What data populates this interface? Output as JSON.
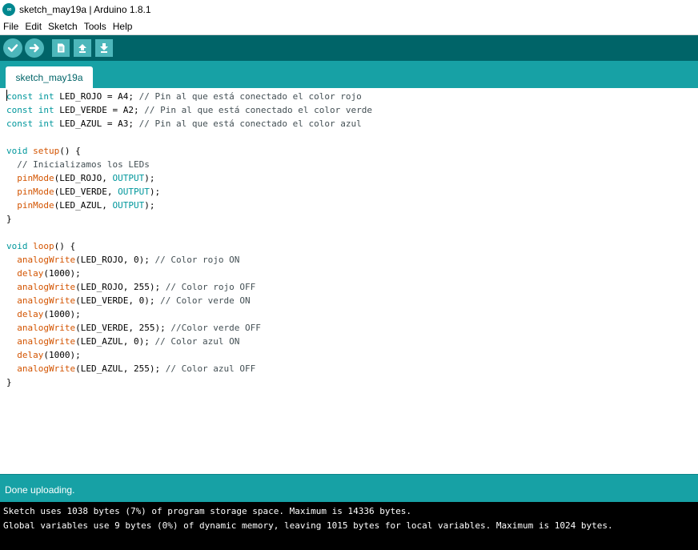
{
  "window": {
    "title": "sketch_may19a | Arduino 1.8.1",
    "logo_icon": "arduino-logo-icon",
    "logo_glyph": "∞"
  },
  "menu": [
    "File",
    "Edit",
    "Sketch",
    "Tools",
    "Help"
  ],
  "toolbar": {
    "buttons": [
      {
        "name": "verify",
        "icon": "checkmark-icon"
      },
      {
        "name": "upload",
        "icon": "arrow-right-icon"
      },
      {
        "name": "new",
        "icon": "new-file-icon"
      },
      {
        "name": "open",
        "icon": "arrow-up-icon"
      },
      {
        "name": "save",
        "icon": "arrow-down-icon"
      }
    ]
  },
  "tab": {
    "label": "sketch_may19a"
  },
  "editor": {
    "lines": [
      [
        {
          "t": "const",
          "c": "kw"
        },
        {
          "t": " "
        },
        {
          "t": "int",
          "c": "kw"
        },
        {
          "t": " LED_ROJO = A4; "
        },
        {
          "t": "// Pin al que está conectado el color rojo",
          "c": "cm"
        }
      ],
      [
        {
          "t": "const",
          "c": "kw"
        },
        {
          "t": " "
        },
        {
          "t": "int",
          "c": "kw"
        },
        {
          "t": " LED_VERDE = A2; "
        },
        {
          "t": "// Pin al que está conectado el color verde",
          "c": "cm"
        }
      ],
      [
        {
          "t": "const",
          "c": "kw"
        },
        {
          "t": " "
        },
        {
          "t": "int",
          "c": "kw"
        },
        {
          "t": " LED_AZUL = A3; "
        },
        {
          "t": "// Pin al que está conectado el color azul",
          "c": "cm"
        }
      ],
      [],
      [
        {
          "t": "void",
          "c": "kw"
        },
        {
          "t": " "
        },
        {
          "t": "setup",
          "c": "fn"
        },
        {
          "t": "() {"
        }
      ],
      [
        {
          "t": "  "
        },
        {
          "t": "// Inicializamos los LEDs",
          "c": "cm"
        }
      ],
      [
        {
          "t": "  "
        },
        {
          "t": "pinMode",
          "c": "fn"
        },
        {
          "t": "(LED_ROJO, "
        },
        {
          "t": "OUTPUT",
          "c": "kw"
        },
        {
          "t": ");"
        }
      ],
      [
        {
          "t": "  "
        },
        {
          "t": "pinMode",
          "c": "fn"
        },
        {
          "t": "(LED_VERDE, "
        },
        {
          "t": "OUTPUT",
          "c": "kw"
        },
        {
          "t": ");"
        }
      ],
      [
        {
          "t": "  "
        },
        {
          "t": "pinMode",
          "c": "fn"
        },
        {
          "t": "(LED_AZUL, "
        },
        {
          "t": "OUTPUT",
          "c": "kw"
        },
        {
          "t": ");"
        }
      ],
      [
        {
          "t": "}"
        }
      ],
      [],
      [
        {
          "t": "void",
          "c": "kw"
        },
        {
          "t": " "
        },
        {
          "t": "loop",
          "c": "fn"
        },
        {
          "t": "() {"
        }
      ],
      [
        {
          "t": "  "
        },
        {
          "t": "analogWrite",
          "c": "fn"
        },
        {
          "t": "(LED_ROJO, 0); "
        },
        {
          "t": "// Color rojo ON",
          "c": "cm"
        }
      ],
      [
        {
          "t": "  "
        },
        {
          "t": "delay",
          "c": "fn"
        },
        {
          "t": "(1000);"
        }
      ],
      [
        {
          "t": "  "
        },
        {
          "t": "analogWrite",
          "c": "fn"
        },
        {
          "t": "(LED_ROJO, 255); "
        },
        {
          "t": "// Color rojo OFF",
          "c": "cm"
        }
      ],
      [
        {
          "t": "  "
        },
        {
          "t": "analogWrite",
          "c": "fn"
        },
        {
          "t": "(LED_VERDE, 0); "
        },
        {
          "t": "// Color verde ON",
          "c": "cm"
        }
      ],
      [
        {
          "t": "  "
        },
        {
          "t": "delay",
          "c": "fn"
        },
        {
          "t": "(1000);"
        }
      ],
      [
        {
          "t": "  "
        },
        {
          "t": "analogWrite",
          "c": "fn"
        },
        {
          "t": "(LED_VERDE, 255); "
        },
        {
          "t": "//Color verde OFF",
          "c": "cm"
        }
      ],
      [
        {
          "t": "  "
        },
        {
          "t": "analogWrite",
          "c": "fn"
        },
        {
          "t": "(LED_AZUL, 0); "
        },
        {
          "t": "// Color azul ON",
          "c": "cm"
        }
      ],
      [
        {
          "t": "  "
        },
        {
          "t": "delay",
          "c": "fn"
        },
        {
          "t": "(1000);"
        }
      ],
      [
        {
          "t": "  "
        },
        {
          "t": "analogWrite",
          "c": "fn"
        },
        {
          "t": "(LED_AZUL, 255); "
        },
        {
          "t": "// Color azul OFF",
          "c": "cm"
        }
      ],
      [
        {
          "t": "}"
        }
      ]
    ]
  },
  "status": {
    "text": "Done uploading."
  },
  "console": {
    "lines": [
      "Sketch uses 1038 bytes (7%) of program storage space. Maximum is 14336 bytes.",
      "Global variables use 9 bytes (0%) of dynamic memory, leaving 1015 bytes for local variables. Maximum is 1024 bytes."
    ]
  },
  "colors": {
    "toolbar_bg": "#006468",
    "tab_strip_bg": "#17a1a5",
    "button_bg": "#4db7bb",
    "keyword": "#00979c",
    "function": "#d35400",
    "comment": "#434f54",
    "console_bg": "#000000"
  }
}
